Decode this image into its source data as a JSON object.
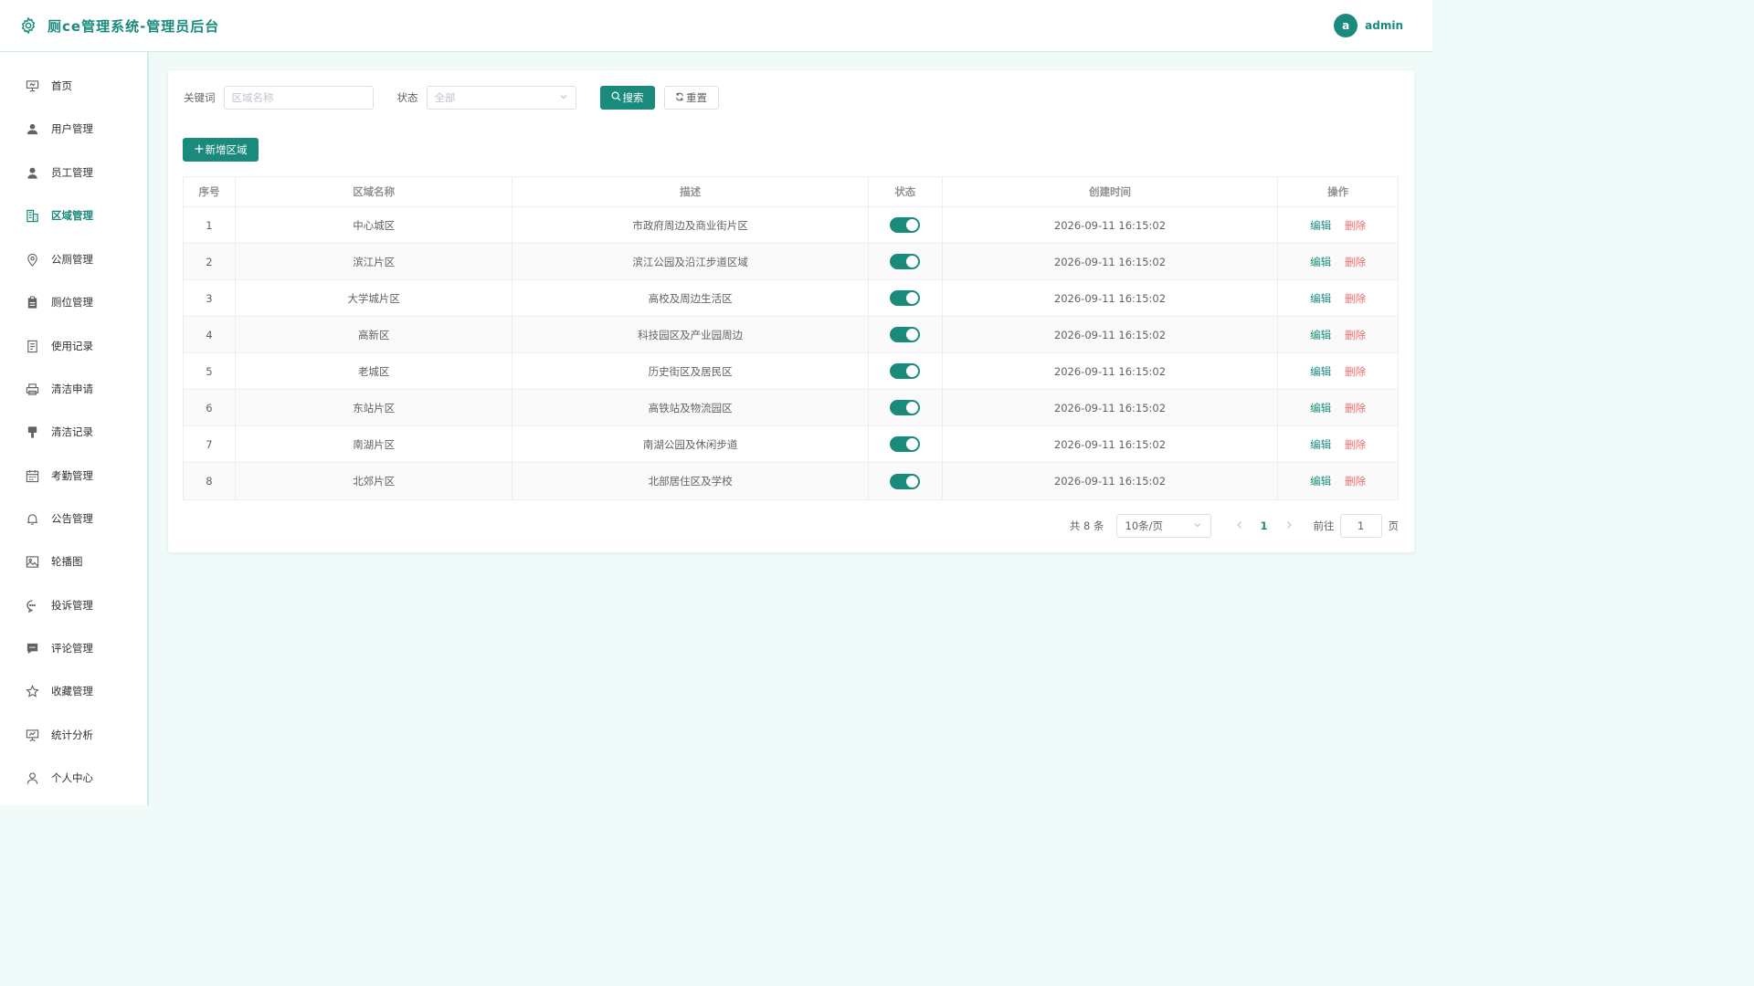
{
  "header": {
    "title": "厕ce管理系统-管理员后台",
    "user_avatar": "a",
    "username": "admin",
    "brand_icon": "gear-icon"
  },
  "sidebar": {
    "items": [
      {
        "label": "首页",
        "icon": "presentation-icon"
      },
      {
        "label": "用户管理",
        "icon": "user-filled-icon"
      },
      {
        "label": "员工管理",
        "icon": "avatar-icon"
      },
      {
        "label": "区域管理",
        "icon": "office-building-icon",
        "active": true
      },
      {
        "label": "公厕管理",
        "icon": "location-icon"
      },
      {
        "label": "厕位管理",
        "icon": "clipboard-icon"
      },
      {
        "label": "使用记录",
        "icon": "document-icon"
      },
      {
        "label": "清洁申请",
        "icon": "printer-icon"
      },
      {
        "label": "清洁记录",
        "icon": "brush-icon"
      },
      {
        "label": "考勤管理",
        "icon": "calendar-icon"
      },
      {
        "label": "公告管理",
        "icon": "bell-icon"
      },
      {
        "label": "轮播图",
        "icon": "picture-icon"
      },
      {
        "label": "投诉管理",
        "icon": "chat-dot-icon"
      },
      {
        "label": "评论管理",
        "icon": "chat-line-icon"
      },
      {
        "label": "收藏管理",
        "icon": "star-icon"
      },
      {
        "label": "统计分析",
        "icon": "data-board-icon"
      },
      {
        "label": "个人中心",
        "icon": "user-icon"
      }
    ]
  },
  "search": {
    "keyword_label": "关键词",
    "keyword_placeholder": "区域名称",
    "status_label": "状态",
    "status_value": "全部",
    "search_button": "搜索",
    "reset_button": "重置"
  },
  "actions": {
    "add_button": "新增区域"
  },
  "table": {
    "columns": [
      "序号",
      "区域名称",
      "描述",
      "状态",
      "创建时间",
      "操作"
    ],
    "rows": [
      {
        "index": "1",
        "name": "中心城区",
        "desc": "市政府周边及商业街片区",
        "enabled": true,
        "created": "2026-09-11 16:15:02"
      },
      {
        "index": "2",
        "name": "滨江片区",
        "desc": "滨江公园及沿江步道区域",
        "enabled": true,
        "created": "2026-09-11 16:15:02"
      },
      {
        "index": "3",
        "name": "大学城片区",
        "desc": "高校及周边生活区",
        "enabled": true,
        "created": "2026-09-11 16:15:02"
      },
      {
        "index": "4",
        "name": "高新区",
        "desc": "科技园区及产业园周边",
        "enabled": true,
        "created": "2026-09-11 16:15:02"
      },
      {
        "index": "5",
        "name": "老城区",
        "desc": "历史街区及居民区",
        "enabled": true,
        "created": "2026-09-11 16:15:02"
      },
      {
        "index": "6",
        "name": "东站片区",
        "desc": "高铁站及物流园区",
        "enabled": true,
        "created": "2026-09-11 16:15:02"
      },
      {
        "index": "7",
        "name": "南湖片区",
        "desc": "南湖公园及休闲步道",
        "enabled": true,
        "created": "2026-09-11 16:15:02"
      },
      {
        "index": "8",
        "name": "北郊片区",
        "desc": "北部居住区及学校",
        "enabled": true,
        "created": "2026-09-11 16:15:02"
      }
    ],
    "edit_label": "编辑",
    "delete_label": "删除"
  },
  "pagination": {
    "total_text": "共 8 条",
    "page_size": "10条/页",
    "current_page": "1",
    "goto_label": "前往",
    "goto_value": "1",
    "page_suffix": "页"
  },
  "colors": {
    "primary": "#1a8a7c",
    "danger": "#f56c6c",
    "background": "#f0faf8"
  }
}
